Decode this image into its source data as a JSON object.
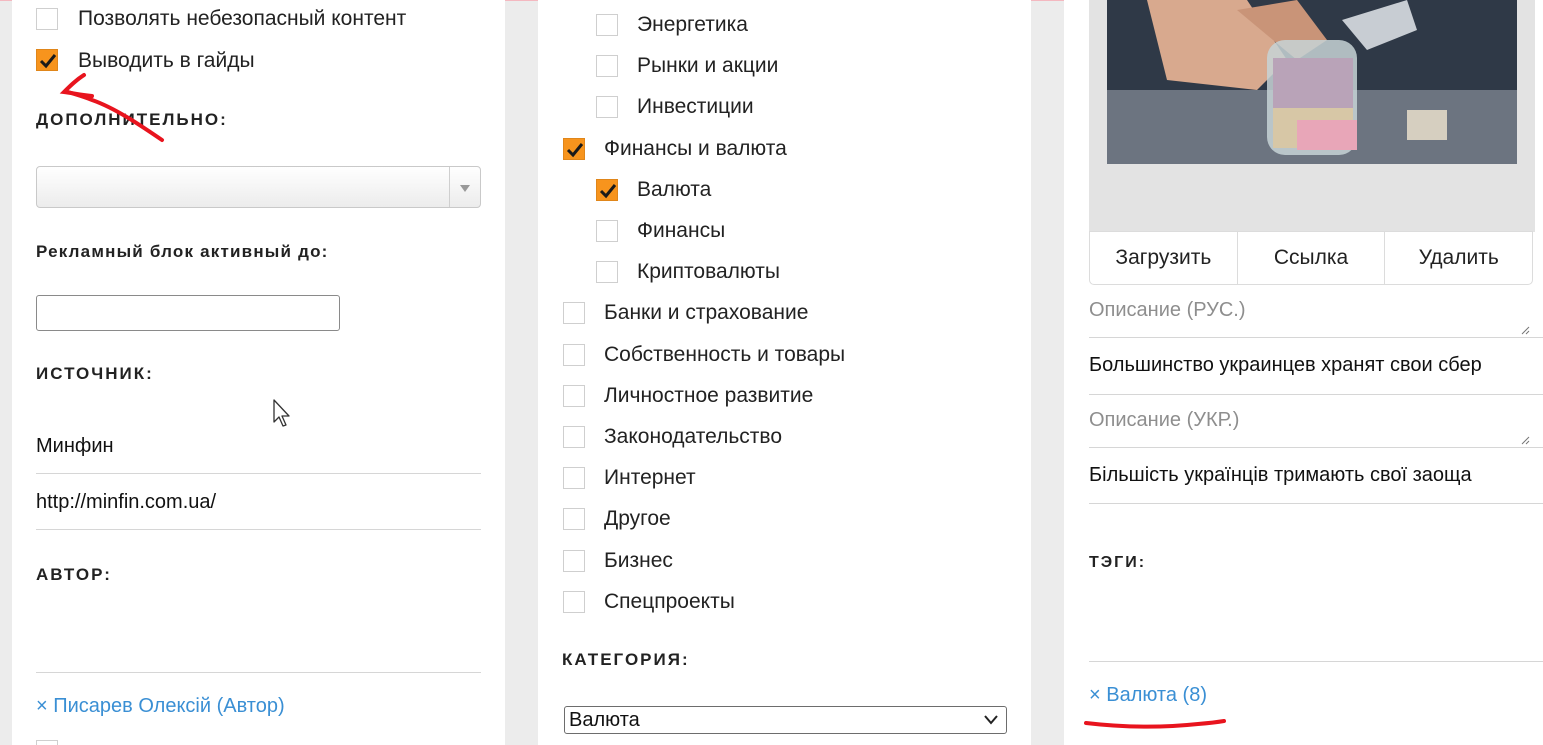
{
  "left_column": {
    "checkboxes": [
      {
        "label": "Позволять небезопасный контент",
        "checked": false
      },
      {
        "label": "Выводить в гайды",
        "checked": true
      }
    ],
    "additional_heading": "ДОПОЛНИТЕЛЬНО:",
    "additional_select_value": "",
    "ad_block_heading": "Рекламный блок активный до:",
    "ad_block_input_value": "",
    "source_heading": "ИСТОЧНИК:",
    "source_name": "Минфин",
    "source_url": "http://minfin.com.ua/",
    "author_heading": "АВТОР:",
    "author_tag": "× Писарев Олексій (Автор)"
  },
  "middle_column": {
    "checkboxes": [
      {
        "label": "Энергетика",
        "checked": false,
        "indent": true
      },
      {
        "label": "Рынки и акции",
        "checked": false,
        "indent": true
      },
      {
        "label": "Инвестиции",
        "checked": false,
        "indent": true
      },
      {
        "label": "Финансы и валюта",
        "checked": true,
        "indent": false
      },
      {
        "label": "Валюта",
        "checked": true,
        "indent": true
      },
      {
        "label": "Финансы",
        "checked": false,
        "indent": true
      },
      {
        "label": "Криптовалюты",
        "checked": false,
        "indent": true
      },
      {
        "label": "Банки и страхование",
        "checked": false,
        "indent": false
      },
      {
        "label": "Собственность и товары",
        "checked": false,
        "indent": false
      },
      {
        "label": "Личностное развитие",
        "checked": false,
        "indent": false
      },
      {
        "label": "Законодательство",
        "checked": false,
        "indent": false
      },
      {
        "label": "Интернет",
        "checked": false,
        "indent": false
      },
      {
        "label": "Другое",
        "checked": false,
        "indent": false
      },
      {
        "label": "Бизнес",
        "checked": false,
        "indent": false
      },
      {
        "label": "Спецпроекты",
        "checked": false,
        "indent": false
      }
    ],
    "category_heading": "КАТЕГОРИЯ:",
    "category_value": "Валюта"
  },
  "right_column": {
    "buttons": {
      "upload": "Загрузить",
      "link": "Ссылка",
      "delete": "Удалить"
    },
    "desc_ru_placeholder": "Описание (РУС.)",
    "desc_ru_text": "Большинство украинцев хранят свои сбер",
    "desc_ua_placeholder": "Описание (УКР.)",
    "desc_ua_text": "Більшість українців тримають свої заоща",
    "tags_heading": "ТЭГИ:",
    "tag": "× Валюта (8)"
  },
  "colors": {
    "checkbox_checked": "#f7941d",
    "link": "#3a8fd4",
    "annotation": "#e8141e"
  },
  "icons": [
    "checkmark-icon",
    "dropdown-arrow-icon",
    "resize-handle-icon",
    "mouse-pointer-icon"
  ]
}
